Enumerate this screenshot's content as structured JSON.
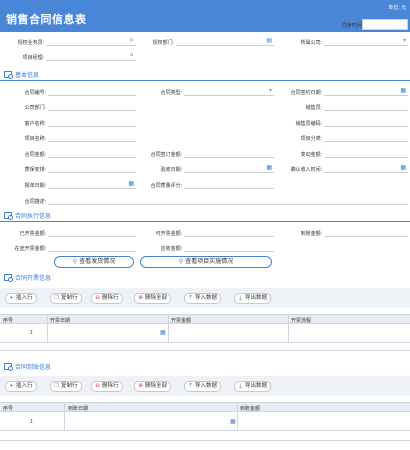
{
  "header": {
    "title": "销售合同信息表",
    "unit_label": "单位:",
    "unit_value": "元",
    "sync_label": "同步时间"
  },
  "top_fields": {
    "authorized_member": "授权业务员:",
    "authorized_dept": "授权部门:",
    "company": "所属公司:",
    "project_manager": "项目经理:"
  },
  "sections": {
    "basic": "基本信息",
    "execution": "合同执行信息",
    "invoice": "合同开票信息",
    "payment": "合同到账信息"
  },
  "basic": {
    "contract_no": "合同编号:",
    "contract_type": "合同类型:",
    "sign_date": "合同签约日期:",
    "company_dept": "公司部门:",
    "salesperson": "销售员:",
    "customer_name": "客户名称:",
    "sales_code": "销售员编码:",
    "project_name": "项目名称:",
    "project_category": "项目分类:",
    "contract_amount": "合同金额:",
    "contract_change_amount": "合同签订金额:",
    "change_amount": "变动金额:",
    "warranty": "质保安排:",
    "acceptance_date": "验收日期:",
    "confirm_income_time": "确认收入时间:",
    "registration_date": "报单日期:",
    "quality_rating": "合同质量评分:",
    "contract_desc": "合同描述:"
  },
  "execution": {
    "invoiced_amount": "已开票金额:",
    "invoiceable_amount": "可开票金额:",
    "received_amount": "到账金额:",
    "outstanding_invoice_amount": "在途开票金额:",
    "receivable_amount": "应收金额:"
  },
  "pills": {
    "view_shipping": "查看发货情况",
    "view_project": "查看项目实施情况"
  },
  "toolbar": {
    "insert": "插入行",
    "copy": "复制行",
    "delete": "删除行",
    "delete_all": "删除全部",
    "import": "导入数据",
    "export": "导出数据"
  },
  "invoice_table": {
    "headers": [
      "序号",
      "开票日期",
      "开票金额",
      "开票流程"
    ],
    "rows": [
      [
        "1",
        "",
        "",
        ""
      ]
    ]
  },
  "payment_table": {
    "headers": [
      "序号",
      "到账日期",
      "到账金额"
    ],
    "rows": [
      [
        "1",
        "",
        ""
      ]
    ]
  },
  "colors": {
    "accent": "#4a86d8",
    "header_bg": "#4a86d8",
    "toolbar_bg": "#eef2f7"
  }
}
